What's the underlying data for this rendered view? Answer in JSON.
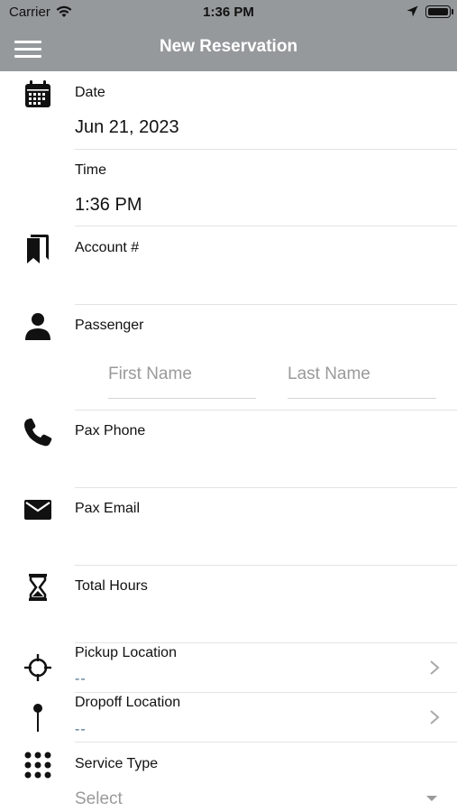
{
  "status_bar": {
    "carrier": "Carrier",
    "time": "1:36 PM"
  },
  "nav": {
    "title": "New Reservation"
  },
  "form": {
    "date": {
      "label": "Date",
      "value": "Jun 21, 2023"
    },
    "time": {
      "label": "Time",
      "value": "1:36 PM"
    },
    "account": {
      "label": "Account #",
      "value": ""
    },
    "passenger": {
      "label": "Passenger",
      "first_placeholder": "First Name",
      "last_placeholder": "Last Name"
    },
    "pax_phone": {
      "label": "Pax Phone",
      "value": ""
    },
    "pax_email": {
      "label": "Pax Email",
      "value": ""
    },
    "total_hours": {
      "label": "Total Hours",
      "value": ""
    },
    "pickup": {
      "label": "Pickup Location",
      "value": "--"
    },
    "dropoff": {
      "label": "Dropoff Location",
      "value": "--"
    },
    "service_type": {
      "label": "Service Type",
      "placeholder": "Select"
    }
  },
  "icons": [
    "calendar-icon",
    "bookmarks-icon",
    "person-icon",
    "phone-icon",
    "envelope-icon",
    "hourglass-icon",
    "crosshair-icon",
    "pin-icon",
    "dots-grid-icon",
    "chevron-right-icon",
    "caret-down-icon"
  ]
}
